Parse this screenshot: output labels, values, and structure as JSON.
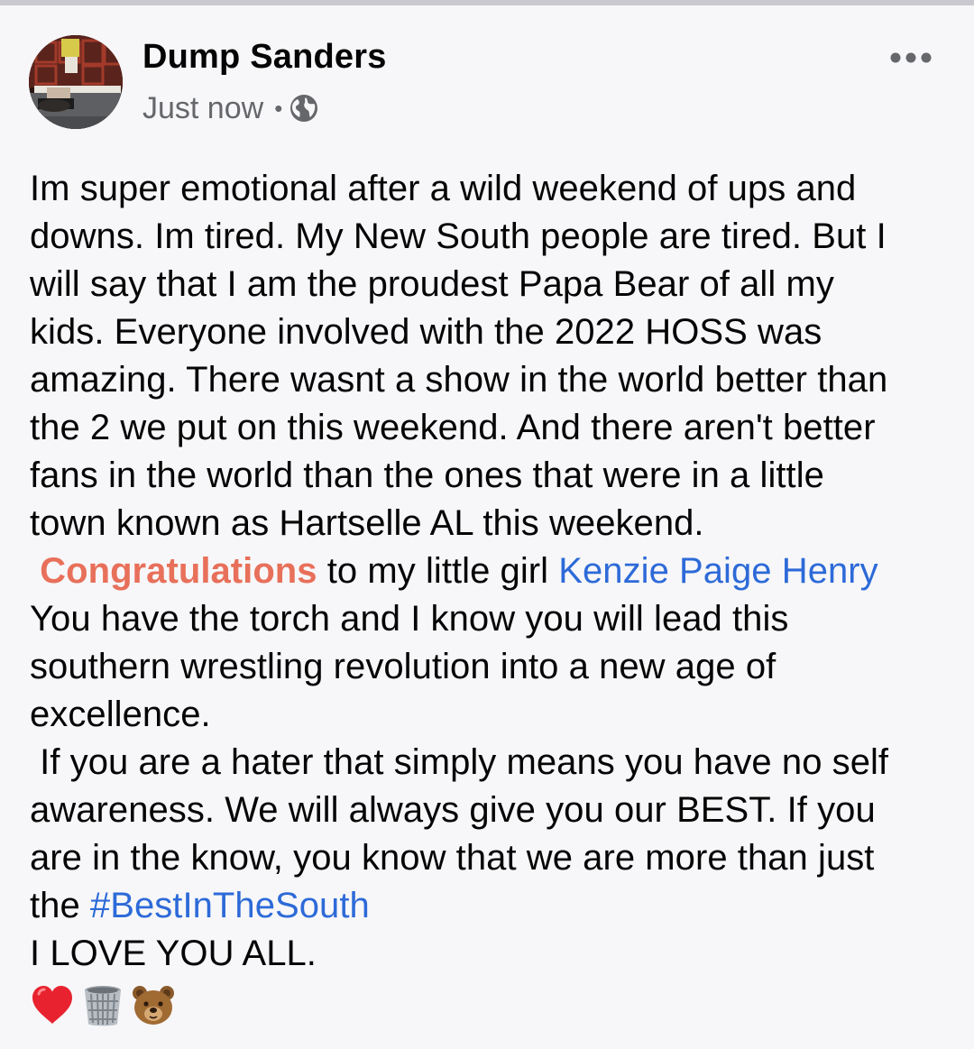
{
  "post": {
    "author": "Dump Sanders",
    "timestamp": "Just now",
    "separator": "•",
    "privacy_icon": "globe-icon",
    "menu_icon": "more-horizontal-icon",
    "lines": {
      "l1": "Im super emotional after a wild weekend of ups and",
      "l2": "downs. Im tired. My New South people are tired. But I",
      "l3": "will say that I am the proudest Papa Bear of all my",
      "l4": "kids. Everyone involved with the 2022 HOSS was",
      "l5": "amazing. There wasnt a show in the world better than",
      "l6": "the 2 we put on this weekend. And there aren't better",
      "l7": "fans in the world than the ones that were in a little",
      "l8": "town known as Hartselle AL this weekend.",
      "l9_congrats": "Congratulations",
      "l9_mid": " to my little girl ",
      "l9_tag": "Kenzie Paige Henry",
      "l10": "You have the torch and I know you will lead this",
      "l11": "southern wrestling revolution into a new age of",
      "l12": "excellence.",
      "l13": " If you are a hater that simply means you have no self",
      "l14": "awareness. We will always give you our BEST. If you",
      "l15": "are in the know, you know that we are more than just",
      "l16_prefix": "the ",
      "l16_hashtag": "#BestInTheSouth",
      "l17": "I LOVE YOU ALL."
    },
    "emojis": [
      "red-heart-icon",
      "wastebasket-icon",
      "bear-face-icon"
    ]
  },
  "colors": {
    "background": "#f7f7f9",
    "text": "#050505",
    "meta_text": "#65676b",
    "link": "#2d6ad8",
    "congrats": "#e8705a"
  }
}
